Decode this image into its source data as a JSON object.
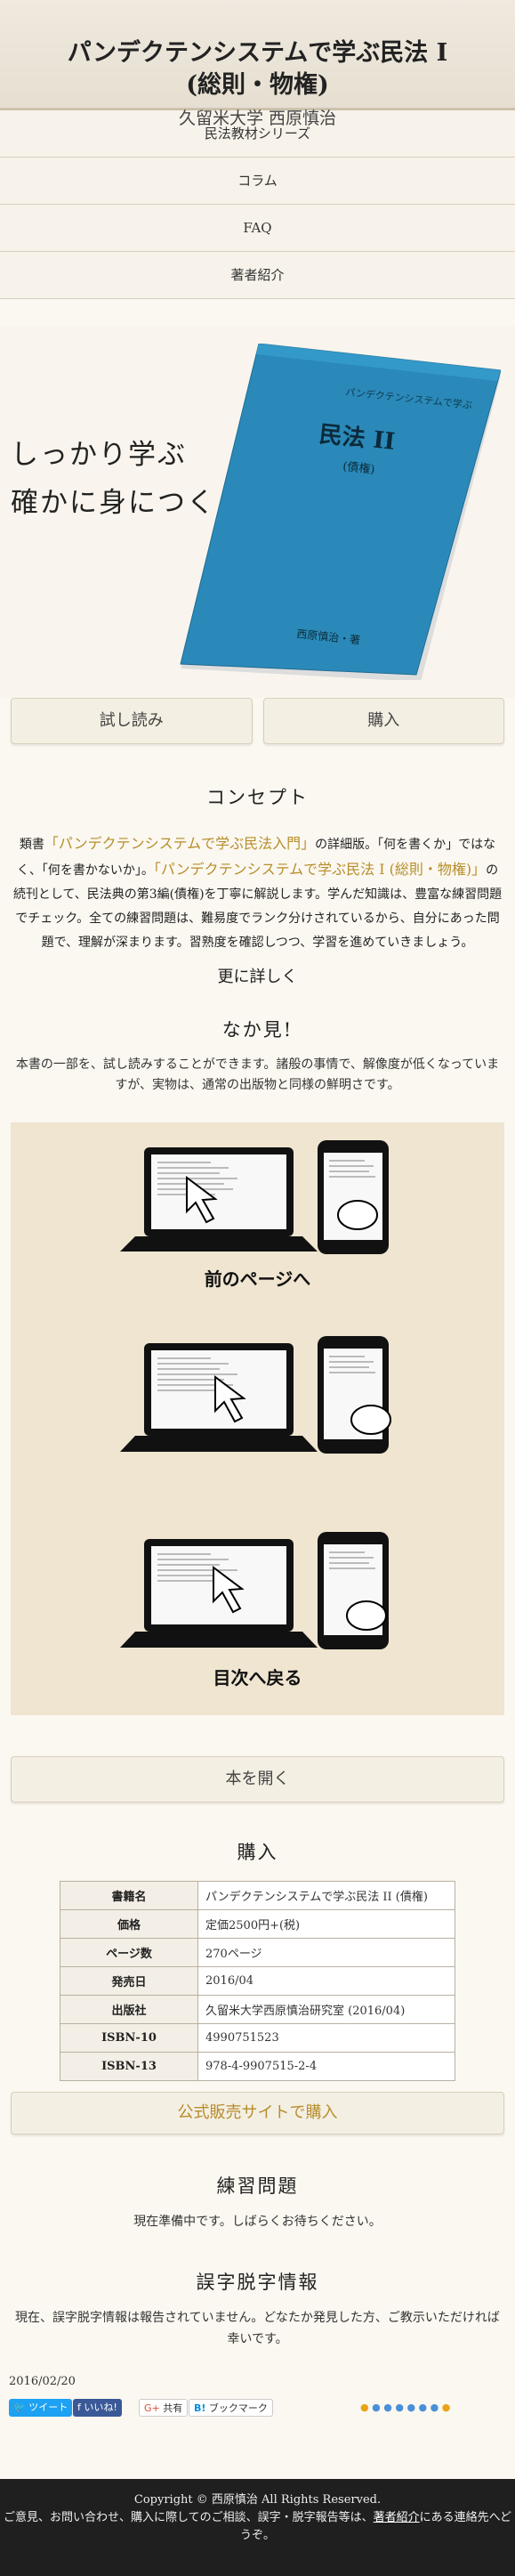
{
  "header": {
    "title_line1": "パンデクテンシステムで学ぶ民法 I",
    "title_line2": "(総則・物権)",
    "author": "久留米大学 西原慎治"
  },
  "nav": [
    {
      "label": "民法教材シリーズ"
    },
    {
      "label": "コラム"
    },
    {
      "label": "FAQ"
    },
    {
      "label": "著者紹介"
    }
  ],
  "hero": {
    "slogan_line1": "しっかり学ぶ",
    "slogan_line2": "確かに身につく",
    "book_series": "パンデクテンシステムで学ぶ",
    "book_title": "民法 II",
    "book_subtitle": "(債権)",
    "book_author": "西原慎治・著"
  },
  "actions": {
    "trial": "試し読み",
    "buy": "購入"
  },
  "concept": {
    "title": "コンセプト",
    "t1": "類書",
    "h1": "「パンデクテンシステムで学ぶ民法入門」",
    "t2": "の詳細版。「何を書くか」ではなく、「何を書かないか」。",
    "h2": "「パンデクテンシステムで学ぶ民法 I (総則・物権)」",
    "t3": "の続刊として、民法典の第3編(債権)を丁寧に解説します。学んだ知識は、豊富な練習問題でチェック。全ての練習問題は、難易度でランク分けされているから、自分にあった問題で、理解が深まります。習熟度を確認しつつ、学習を進めていきましょう。",
    "more": "更に詳しく"
  },
  "peek": {
    "title": "なか見!",
    "text": "本書の一部を、試し読みすることができます。諸般の事情で、解像度が低くなっていますが、実物は、通常の出版物と同様の鮮明さです。",
    "step1": "前のページへ",
    "step3": "目次へ戻る",
    "open": "本を開く"
  },
  "buy": {
    "title": "購入",
    "rows": [
      {
        "key": "書籍名",
        "value": "パンデクテンシステムで学ぶ民法 II (債権)"
      },
      {
        "key": "価格",
        "value": "定価2500円+(税)"
      },
      {
        "key": "ページ数",
        "value": "270ページ"
      },
      {
        "key": "発売日",
        "value": "2016/04"
      },
      {
        "key": "出版社",
        "value": "久留米大学西原慎治研究室 (2016/04)"
      },
      {
        "key": "ISBN-10",
        "value": "4990751523"
      },
      {
        "key": "ISBN-13",
        "value": "978-4-9907515-2-4"
      }
    ],
    "official": "公式販売サイトで購入"
  },
  "exercise": {
    "title": "練習問題",
    "text": "現在準備中です。しばらくお待ちください。"
  },
  "errata": {
    "title": "誤字脱字情報",
    "text": "現在、誤字脱字情報は報告されていません。どなたか発見した方、ご教示いただければ幸いです。"
  },
  "date": "2016/02/20",
  "share": {
    "tweet": "ツイート",
    "like": "いいね!",
    "gplus": "共有",
    "hatena": "ブックマーク"
  },
  "footer": {
    "copyright": "Copyright © 西原慎治 All Rights Reserved.",
    "line2a": "ご意見、お問い合わせ、購入に際してのご相談、誤字・脱字報告等は、",
    "line2link": "著者紹介",
    "line2b": "にある連絡先へどうぞ。"
  },
  "colors": {
    "accent": "#b68d2a",
    "book": "#2a89b8",
    "footer_bg": "#1f1f1f"
  }
}
